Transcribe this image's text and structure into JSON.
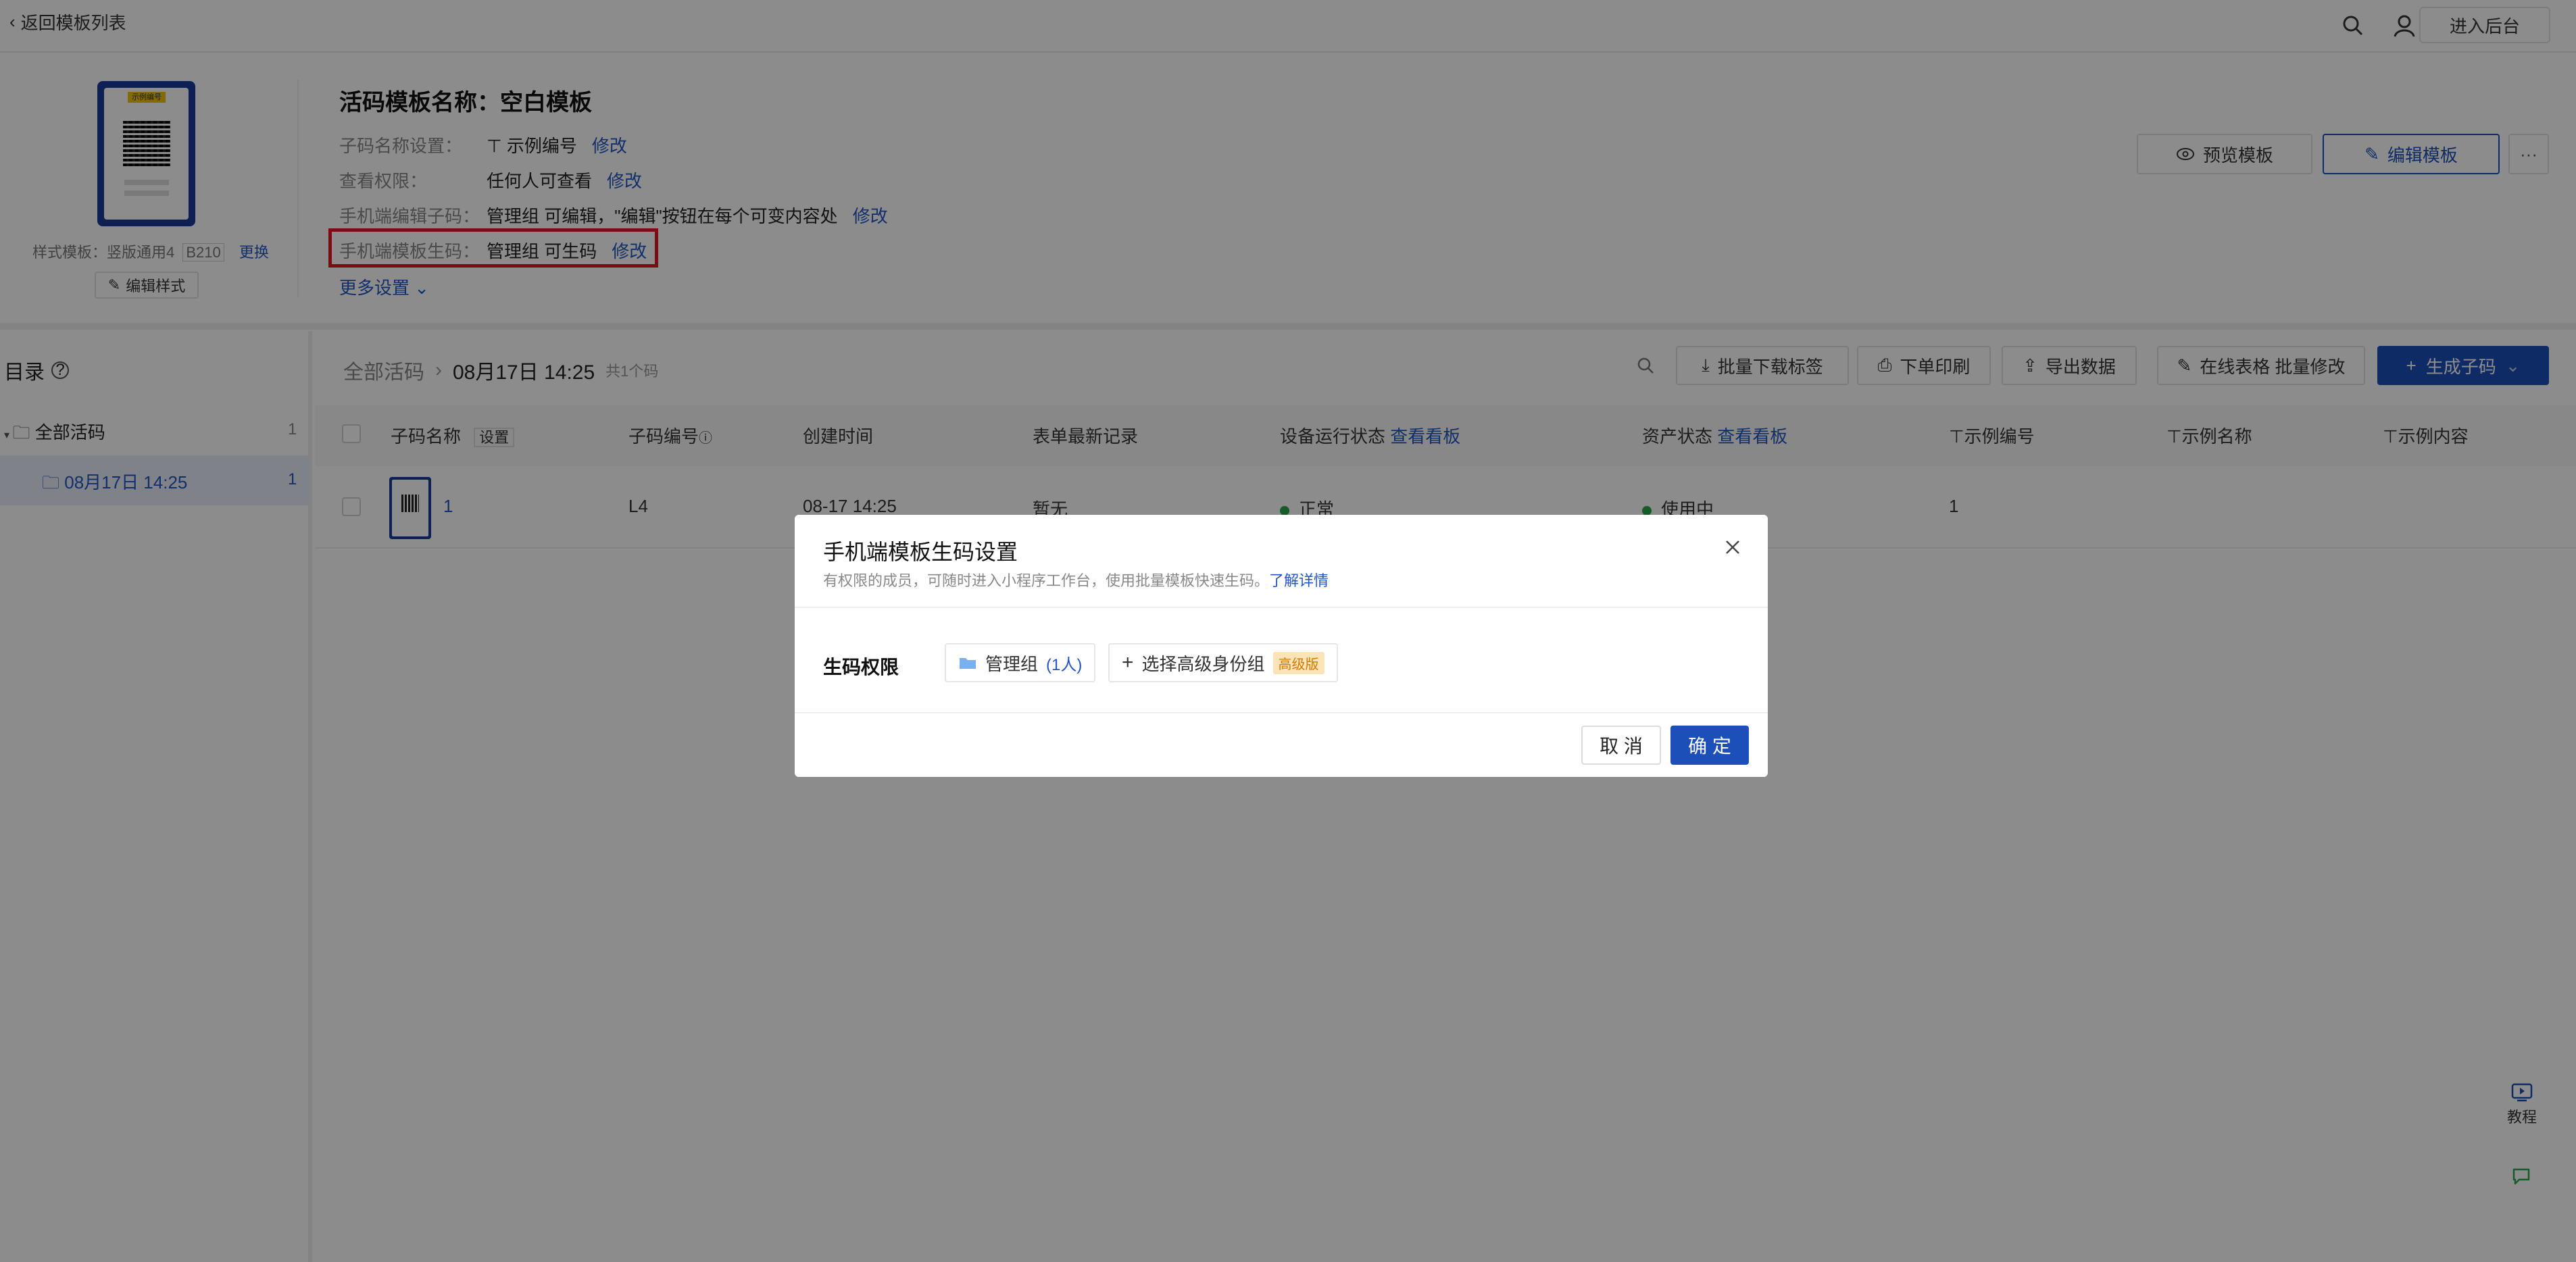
{
  "topbar": {
    "back_label": "返回模板列表",
    "backend_label": "进入后台",
    "icons": [
      "search-icon",
      "user-icon"
    ]
  },
  "template": {
    "preview_tag": "示例编号",
    "style_label": "样式模板：竖版通用4",
    "style_code": "B210",
    "change_label": "更换",
    "edit_style_label": "编辑样式",
    "title": "活码模板名称：空白模板",
    "rows": [
      {
        "key": "子码名称设置：",
        "value": "示例编号",
        "action": "修改"
      },
      {
        "key": "查看权限：",
        "value": "任何人可查看",
        "action": "修改"
      },
      {
        "key": "手机端编辑子码：",
        "value": "管理组 可编辑，\"编辑\"按钮在每个可变内容处",
        "action": "修改"
      },
      {
        "key": "手机端模板生码：",
        "value": "管理组 可生码",
        "action": "修改"
      }
    ],
    "more_settings": "更多设置",
    "preview_btn": "预览模板",
    "edit_btn": "编辑模板",
    "more_btn": "···"
  },
  "sidebar": {
    "title": "目录",
    "items": [
      {
        "label": "全部活码",
        "count": "1"
      },
      {
        "label": "08月17日 14:25",
        "count": "1"
      }
    ]
  },
  "toolbar": {
    "crumb_root": "全部活码",
    "crumb_current": "08月17日 14:25",
    "crumb_count": "共1个码",
    "batch_download": "批量下载标签",
    "print": "下单印刷",
    "export": "导出数据",
    "online_edit": "在线表格 批量修改",
    "generate": "生成子码"
  },
  "table": {
    "headers": {
      "name": "子码名称",
      "name_setting": "设置",
      "code": "子码编号",
      "created": "创建时间",
      "latest": "表单最新记录",
      "device": "设备运行状态",
      "device_link": "查看看板",
      "asset": "资产状态",
      "asset_link": "查看看板",
      "ex_code": "示例编号",
      "ex_name": "示例名称",
      "ex_content": "示例内容"
    },
    "rows": [
      {
        "name": "1",
        "code": "L4",
        "created": "08-17 14:25",
        "latest": "暂无",
        "device": "正常",
        "asset": "使用中",
        "ex_code": "1",
        "ex_name": "",
        "ex_content": ""
      }
    ]
  },
  "modal": {
    "title": "手机端模板生码设置",
    "subtitle": "有权限的成员，可随时进入小程序工作台，使用批量模板快速生码。",
    "subtitle_link": "了解详情",
    "perm_label": "生码权限",
    "group_name": "管理组",
    "group_count": "(1人)",
    "add_group": "选择高级身份组",
    "add_badge": "高级版",
    "cancel": "取 消",
    "ok": "确 定"
  },
  "floating": {
    "tutorial": "教程"
  },
  "colors": {
    "primary": "#1c4fb8",
    "link": "#2256c2",
    "highlight_box": "#e0161f",
    "status_green": "#2ba84a"
  }
}
